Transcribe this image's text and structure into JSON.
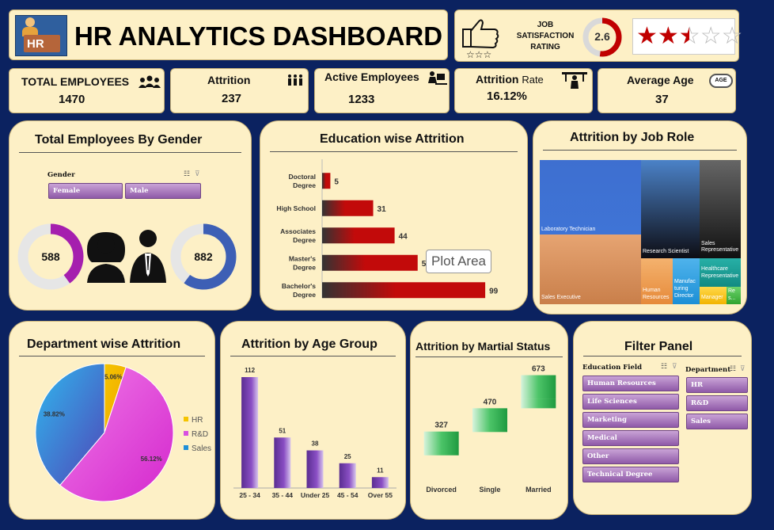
{
  "header": {
    "title": "HR ANALYTICS DASHBOARD",
    "logo_text": "HR"
  },
  "rating": {
    "label_line1": "JOB",
    "label_line2": "SATISFACTION",
    "label_line3": "RATING",
    "value": "2.6",
    "stars_filled": 2.5,
    "stars_total": 5
  },
  "kpis": [
    {
      "label": "TOTAL EMPLOYEES",
      "value": "1470",
      "icon": "group-icon"
    },
    {
      "label": "Attrition",
      "value": "237",
      "icon": "people-leaving-icon"
    },
    {
      "label": "Active Employees",
      "value": "1233",
      "icon": "worker-desk-icon"
    },
    {
      "label_main": "Attrition",
      "label_small": "Rate",
      "value": "16.12%",
      "icon": "presenter-icon"
    },
    {
      "label": "Average Age",
      "value": "37",
      "icon": "age-badge-icon",
      "badge": "AGE"
    }
  ],
  "gender": {
    "title": "Total Employees By Gender",
    "slicer_header": "Gender",
    "options": [
      "Female",
      "Male"
    ],
    "female_value": "588",
    "male_value": "882",
    "female_fraction": 0.4,
    "male_fraction": 0.6,
    "female_color": "#a51fae",
    "male_color": "#3d5fb5"
  },
  "education": {
    "title": "Education wise Attrition",
    "tooltip": "Plot Area",
    "chart_data": {
      "type": "bar",
      "orientation": "horizontal",
      "categories": [
        "Doctoral Degree",
        "High School",
        "Associates Degree",
        "Master's Degree",
        "Bachelor's Degree"
      ],
      "category_lines": [
        [
          "Doctoral",
          "Degree"
        ],
        [
          "High School"
        ],
        [
          "Associates",
          "Degree"
        ],
        [
          "Master's",
          "Degree"
        ],
        [
          "Bachelor's",
          "Degree"
        ]
      ],
      "values": [
        5,
        31,
        44,
        58,
        99
      ],
      "value_labels": [
        "5",
        "31",
        "44",
        "5",
        "99"
      ],
      "xlim": [
        0,
        110
      ],
      "color": "#c20a0a"
    }
  },
  "jobrole": {
    "title": "Attrition by Job Role",
    "tiles": [
      "Laboratory Technician",
      "Sales Executive",
      "Research Scientist",
      "Sales Representative",
      "Human Resources",
      "Manufacturing Director",
      "Healthcare Representative",
      "Manager",
      "Re s..."
    ],
    "tile_lines": [
      [
        "Laboratory Technician"
      ],
      [
        "Sales Executive"
      ],
      [
        "Research Scientist"
      ],
      [
        "Sales",
        "Representative"
      ],
      [
        "Human",
        "Resources"
      ],
      [
        "Manufac",
        "turing",
        "Director"
      ],
      [
        "Healthcare",
        "Representative"
      ],
      [
        "Manager"
      ],
      [
        "Re",
        "s..."
      ]
    ]
  },
  "department": {
    "title": "Department wise Attrition",
    "chart_data": {
      "type": "pie",
      "categories": [
        "HR",
        "R&D",
        "Sales"
      ],
      "values": [
        5.06,
        56.12,
        38.82
      ],
      "labels": [
        "5.06%",
        "56.12%",
        "38.82%"
      ],
      "colors": [
        "#f5c400",
        "#d84fe0",
        "#1f8fd8"
      ],
      "legend": "right"
    }
  },
  "agegroup": {
    "title": "Attrition by Age Group",
    "chart_data": {
      "type": "bar",
      "categories": [
        "25 - 34",
        "35 - 44",
        "Under 25",
        "45 - 54",
        "Over 55"
      ],
      "values": [
        112,
        51,
        38,
        25,
        11
      ],
      "ylim": [
        0,
        120
      ],
      "color": "#7a3fb0"
    }
  },
  "marital": {
    "title": "Attrition by Martial Status",
    "chart_data": {
      "type": "bar",
      "subtype": "waterfall",
      "categories": [
        "Divorced",
        "Single",
        "Married"
      ],
      "values": [
        327,
        470,
        673
      ],
      "ylim": [
        0,
        700
      ],
      "color": "#22a84a"
    }
  },
  "filter": {
    "title": "Filter Panel",
    "education_header": "Education Field",
    "education_options": [
      "Human Resources",
      "Life Sciences",
      "Marketing",
      "Medical",
      "Other",
      "Technical Degree"
    ],
    "department_header": "Department",
    "department_options": [
      "HR",
      "R&D",
      "Sales"
    ]
  }
}
